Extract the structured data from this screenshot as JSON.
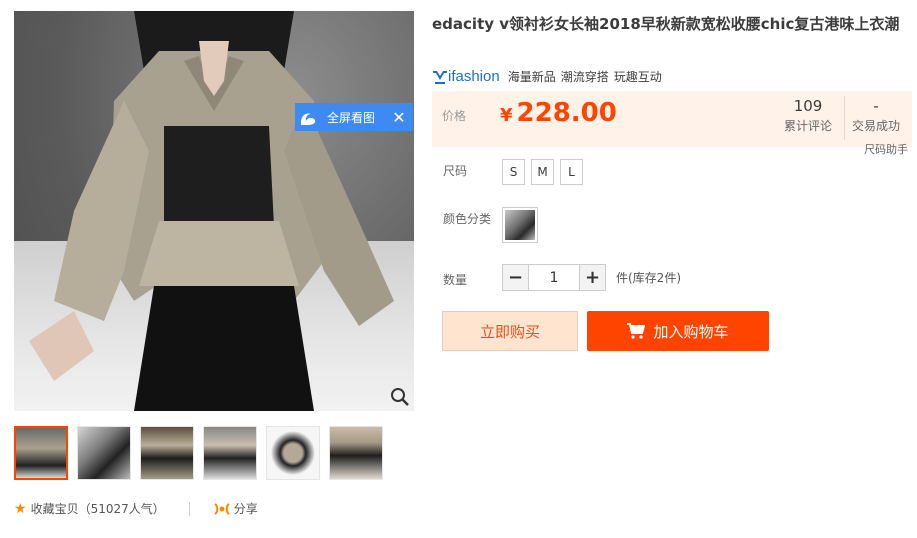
{
  "gallery": {
    "fullscreen_label": "全屏看图",
    "thumbnail_count": 6
  },
  "product": {
    "title": "edacity v领衬衫女长袖2018早秋新款宽松收腰chic复古港味上衣潮",
    "brand_logo": "ifashion",
    "brand_tags": [
      "海量新品",
      "潮流穿搭",
      "玩趣互动"
    ]
  },
  "price": {
    "label": "价格",
    "currency": "¥",
    "value": "228.00",
    "reviews_count": "109",
    "reviews_label": "累计评论",
    "sold_count": "-",
    "sold_label": "交易成功"
  },
  "size_helper": "尺码助手",
  "size": {
    "label": "尺码",
    "options": [
      "S",
      "M",
      "L"
    ]
  },
  "color": {
    "label": "颜色分类"
  },
  "quantity": {
    "label": "数量",
    "value": "1",
    "stock_text": "件(库存2件)"
  },
  "actions": {
    "buy_now": "立即购买",
    "add_to_cart": "加入购物车",
    "favorite": "收藏宝贝（51027人气）",
    "share": "分享"
  },
  "colors": {
    "accent": "#ff4400",
    "price": "#ff4400",
    "price_bg": "#fff2e8",
    "overlay_blue": "#3d8bf0"
  }
}
